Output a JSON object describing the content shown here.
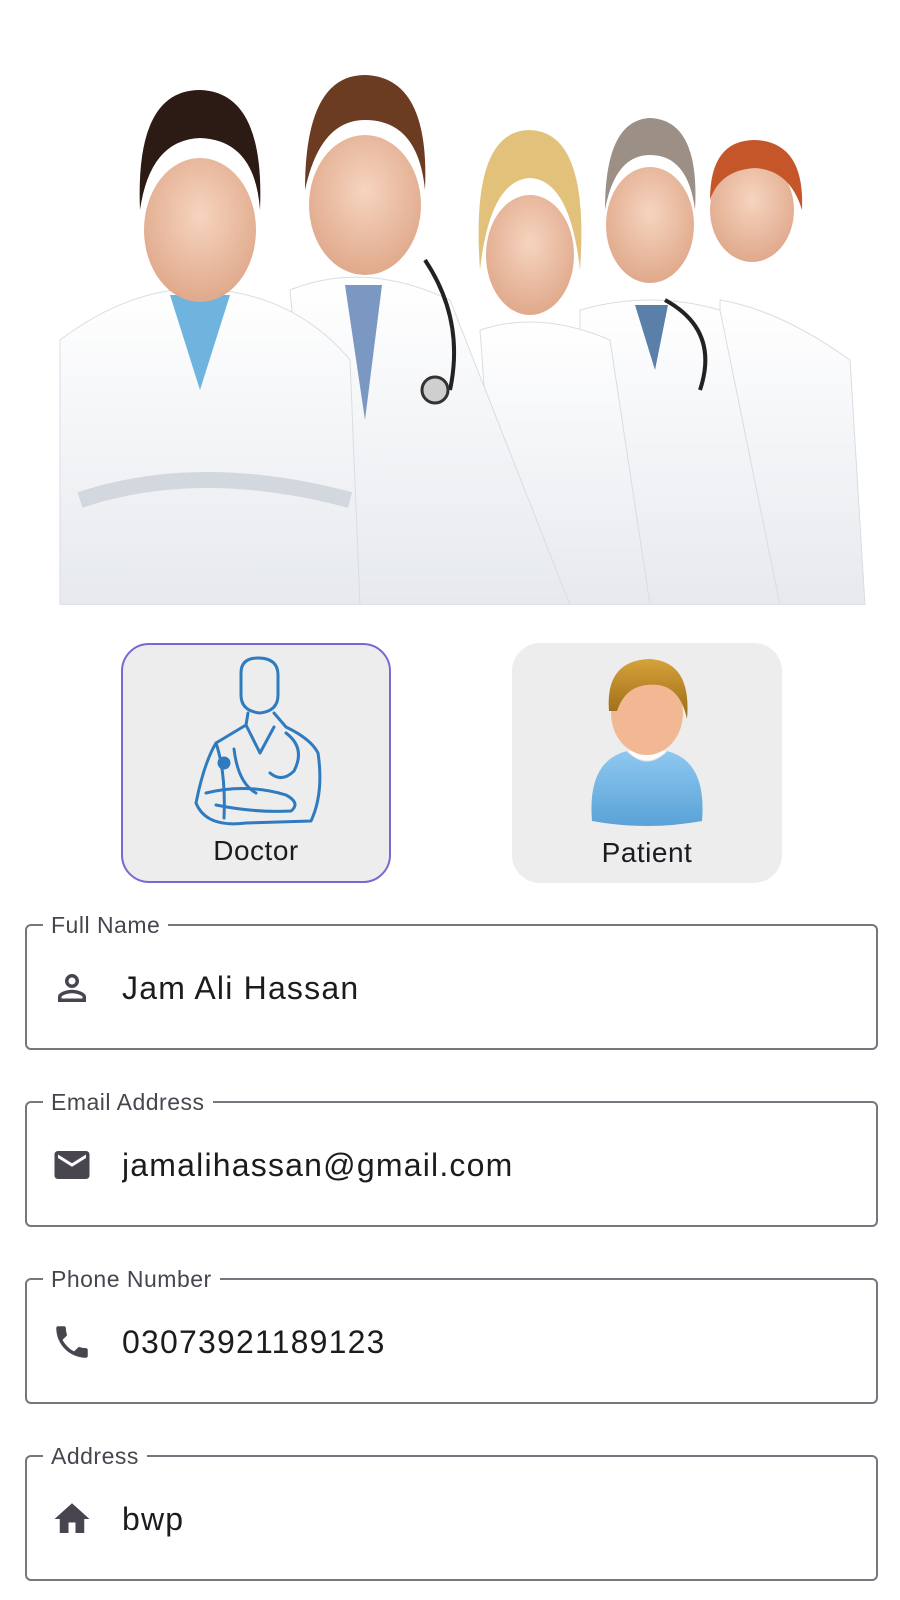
{
  "hero": {
    "image": "medical-team-photo"
  },
  "roles": [
    {
      "label": "Doctor",
      "icon": "doctor-icon",
      "selected": true
    },
    {
      "label": "Patient",
      "icon": "patient-icon",
      "selected": false
    }
  ],
  "form": {
    "full_name": {
      "label": "Full Name",
      "value": "Jam Ali Hassan",
      "icon": "person-icon"
    },
    "email": {
      "label": "Email Address",
      "value": "jamalihassan@gmail.com",
      "icon": "mail-icon"
    },
    "phone": {
      "label": "Phone Number",
      "value": "03073921189123",
      "icon": "phone-icon"
    },
    "address": {
      "label": "Address",
      "value": "bwp",
      "icon": "home-icon"
    }
  },
  "colors": {
    "selected_border": "#7a68d4",
    "card_bg": "#ededed",
    "outline": "#79747e",
    "doctor_icon": "#2f7bbf"
  }
}
